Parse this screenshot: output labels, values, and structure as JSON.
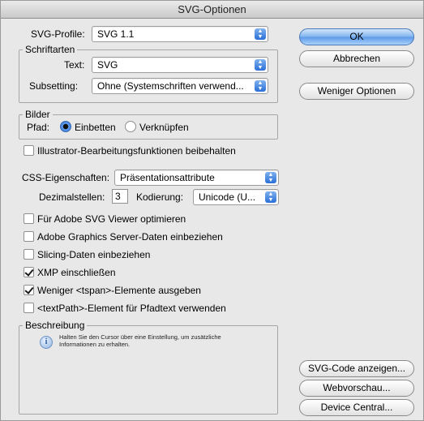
{
  "window": {
    "title": "SVG-Optionen"
  },
  "svg_profile": {
    "label": "SVG-Profile:",
    "value": "SVG 1.1"
  },
  "fonts": {
    "group_title": "Schriftarten",
    "text_label": "Text:",
    "text_value": "SVG",
    "subsetting_label": "Subsetting:",
    "subsetting_value": "Ohne (Systemschriften verwend..."
  },
  "images": {
    "group_title": "Bilder",
    "path_label": "Pfad:",
    "embed_label": "Einbetten",
    "embed_selected": true,
    "link_label": "Verknüpfen",
    "link_selected": false
  },
  "illustrator_edit": {
    "label": "Illustrator-Bearbeitungsfunktionen beibehalten",
    "checked": false
  },
  "css": {
    "label": "CSS-Eigenschaften:",
    "value": "Präsentationsattribute"
  },
  "decimals": {
    "label": "Dezimalstellen:",
    "value": "3"
  },
  "encoding": {
    "label": "Kodierung:",
    "value": "Unicode (U..."
  },
  "checkboxes": [
    {
      "label": "Für Adobe SVG Viewer optimieren",
      "checked": false
    },
    {
      "label": "Adobe Graphics Server-Daten einbeziehen",
      "checked": false
    },
    {
      "label": "Slicing-Daten einbeziehen",
      "checked": false
    },
    {
      "label": "XMP einschließen",
      "checked": true
    },
    {
      "label": "Weniger <tspan>-Elemente ausgeben",
      "checked": true
    },
    {
      "label": "<textPath>-Element für Pfadtext verwenden",
      "checked": false
    }
  ],
  "description": {
    "group_title": "Beschreibung",
    "text": "Halten Sie den Cursor über eine Einstellung, um zusätzliche Informationen zu erhalten."
  },
  "buttons": {
    "ok": "OK",
    "cancel": "Abbrechen",
    "fewer_options": "Weniger Optionen",
    "show_svg_code": "SVG-Code anzeigen...",
    "web_preview": "Webvorschau...",
    "device_central": "Device Central..."
  },
  "icons": {
    "select_arrows": "up-down-arrows-icon",
    "info": "info-icon"
  },
  "colors": {
    "accent": "#2f73d9",
    "default_button": "#7fb3ef"
  }
}
